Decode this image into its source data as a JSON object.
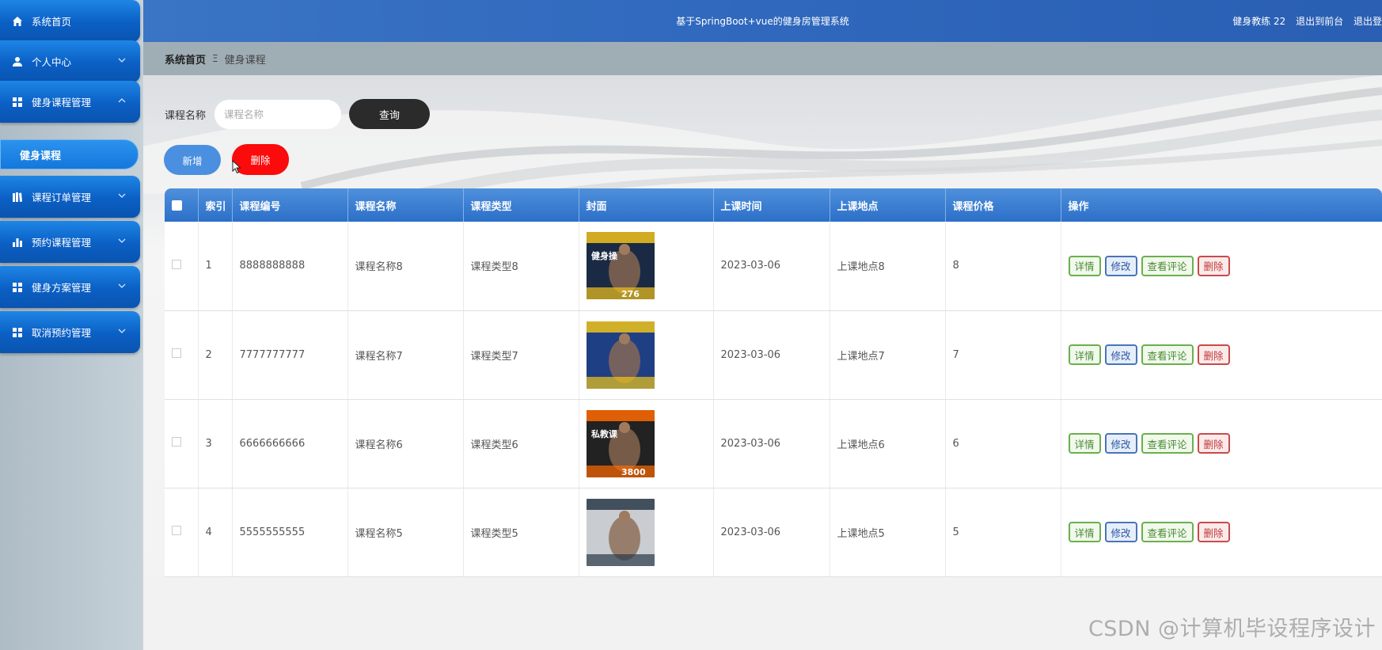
{
  "sidebar": {
    "items": [
      {
        "label": "系统首页",
        "icon": "home-icon"
      },
      {
        "label": "个人中心",
        "icon": "user-icon"
      },
      {
        "label": "健身课程管理",
        "icon": "grid-icon"
      },
      {
        "label": "课程订单管理",
        "icon": "book-icon"
      },
      {
        "label": "预约课程管理",
        "icon": "bar-chart-icon"
      },
      {
        "label": "健身方案管理",
        "icon": "grid-icon"
      },
      {
        "label": "取消预约管理",
        "icon": "grid-icon"
      }
    ],
    "active_sub": "健身课程"
  },
  "header": {
    "title": "基于SpringBoot+vue的健身房管理系统",
    "user": "健身教练 22",
    "front_link": "退出到前台",
    "logout": "退出登"
  },
  "breadcrumb": {
    "home": "系统首页",
    "separator": "Ξ",
    "current": "健身课程"
  },
  "search": {
    "label": "课程名称",
    "placeholder": "课程名称",
    "button": "查询"
  },
  "actions": {
    "add": "新增",
    "delete": "删除"
  },
  "table": {
    "headers": [
      "索引",
      "课程编号",
      "课程名称",
      "课程类型",
      "封面",
      "上课时间",
      "上课地点",
      "课程价格",
      "操作"
    ],
    "row_actions": [
      "详情",
      "修改",
      "查看评论",
      "删除"
    ],
    "rows": [
      {
        "index": "1",
        "code": "8888888888",
        "name": "课程名称8",
        "type": "课程类型8",
        "time": "2023-03-06",
        "place": "上课地点8",
        "price": "8",
        "cover": {
          "bg": "#1a2a44",
          "accent": "#f2c21b",
          "text": "健身操",
          "sub": "276"
        }
      },
      {
        "index": "2",
        "code": "7777777777",
        "name": "课程名称7",
        "type": "课程类型7",
        "time": "2023-03-06",
        "place": "上课地点7",
        "price": "7",
        "cover": {
          "bg": "#1f3f85",
          "accent": "#f0c419",
          "text": "",
          "sub": ""
        }
      },
      {
        "index": "3",
        "code": "6666666666",
        "name": "课程名称6",
        "type": "课程类型6",
        "time": "2023-03-06",
        "place": "上课地点6",
        "price": "6",
        "cover": {
          "bg": "#222222",
          "accent": "#ff6a00",
          "text": "私教课",
          "sub": "3800"
        }
      },
      {
        "index": "4",
        "code": "5555555555",
        "name": "课程名称5",
        "type": "课程类型5",
        "time": "2023-03-06",
        "place": "上课地点5",
        "price": "5",
        "cover": {
          "bg": "#c9ccd1",
          "accent": "#2a3a4a",
          "text": "",
          "sub": ""
        }
      }
    ]
  },
  "watermark": "CSDN @计算机毕设程序设计"
}
